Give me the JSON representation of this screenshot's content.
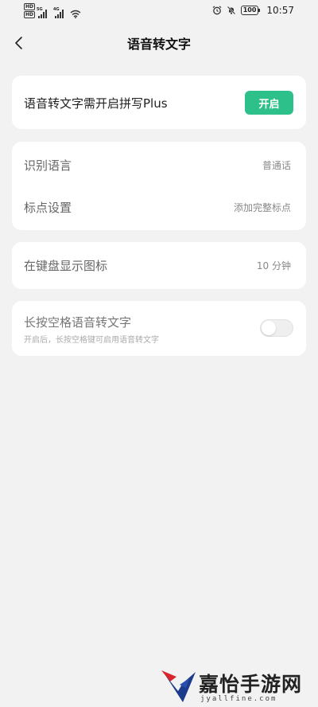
{
  "status_bar": {
    "time": "10:57",
    "battery": "100",
    "sim1_label": "HD",
    "sim2_label": "HD",
    "net1": "5G",
    "net2": "4G"
  },
  "header": {
    "title": "语音转文字"
  },
  "plus_card": {
    "label": "语音转文字需开启拼写Plus",
    "button_label": "开启",
    "button_color": "#2ec08a"
  },
  "settings_card": {
    "items": [
      {
        "label": "识别语言",
        "value": "普通话"
      },
      {
        "label": "标点设置",
        "value": "添加完整标点"
      }
    ]
  },
  "display_card": {
    "label": "在键盘显示图标",
    "value": "10 分钟"
  },
  "long_press_card": {
    "title": "长按空格语音转文字",
    "subtitle": "开启后，长按空格键可启用语音转文字",
    "enabled": false
  },
  "watermark": {
    "text": "嘉怡手游网",
    "url": "jyallfine.com"
  }
}
